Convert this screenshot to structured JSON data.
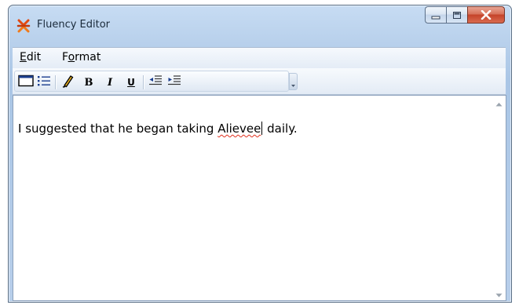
{
  "window": {
    "title": "Fluency Editor",
    "icon": "fluency-app-icon"
  },
  "caption": {
    "minimize_icon": "minimize-icon",
    "maximize_icon": "maximize-icon",
    "close_icon": "close-icon"
  },
  "menu": {
    "items": [
      {
        "label_mnemonic": "E",
        "label_rest": "dit"
      },
      {
        "label_prefix": "F",
        "label_mnemonic": "o",
        "label_rest": "rmat"
      }
    ]
  },
  "toolbar": {
    "buttons": [
      {
        "icon": "window-view-icon"
      },
      {
        "icon": "bulleted-list-icon"
      },
      {
        "icon": "pencil-icon"
      },
      {
        "icon": "bold-icon",
        "glyph": "B"
      },
      {
        "icon": "italic-icon",
        "glyph": "I"
      },
      {
        "icon": "underline-icon",
        "glyph": "U"
      },
      {
        "icon": "decrease-indent-icon"
      },
      {
        "icon": "increase-indent-icon"
      }
    ],
    "overflow_icon": "toolbar-overflow-icon"
  },
  "editor": {
    "text_before": "I suggested that he began taking ",
    "misspelled_word": "Alievee",
    "text_after": " daily."
  },
  "colors": {
    "close_button": "#c5432a",
    "spellcheck_underline": "#e0301e",
    "frame": "#b9d1ec"
  }
}
